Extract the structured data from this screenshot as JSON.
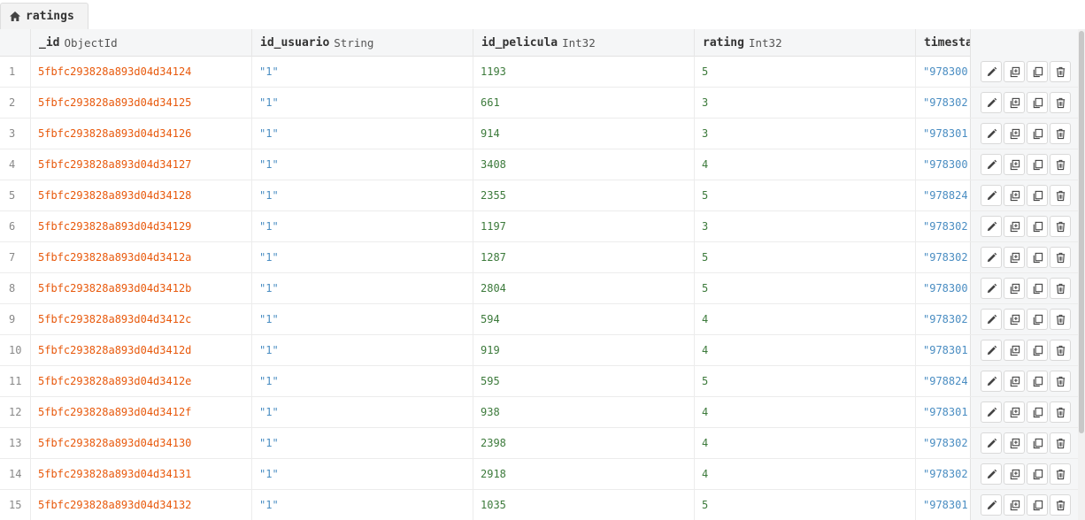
{
  "tab": {
    "icon": "home-icon",
    "label": "ratings"
  },
  "columns": [
    {
      "name": "_id",
      "type": "ObjectId"
    },
    {
      "name": "id_usuario",
      "type": "String"
    },
    {
      "name": "id_pelicula",
      "type": "Int32"
    },
    {
      "name": "rating",
      "type": "Int32"
    },
    {
      "name": "timesta",
      "type": ""
    }
  ],
  "actions": [
    "edit-icon",
    "clone-icon",
    "copy-icon",
    "delete-icon"
  ],
  "rows": [
    {
      "n": "1",
      "id": "5fbfc293828a893d04d34124",
      "usuario": "\"1\"",
      "pelicula": "1193",
      "rating": "5",
      "ts": "\"978300"
    },
    {
      "n": "2",
      "id": "5fbfc293828a893d04d34125",
      "usuario": "\"1\"",
      "pelicula": "661",
      "rating": "3",
      "ts": "\"978302"
    },
    {
      "n": "3",
      "id": "5fbfc293828a893d04d34126",
      "usuario": "\"1\"",
      "pelicula": "914",
      "rating": "3",
      "ts": "\"978301"
    },
    {
      "n": "4",
      "id": "5fbfc293828a893d04d34127",
      "usuario": "\"1\"",
      "pelicula": "3408",
      "rating": "4",
      "ts": "\"978300"
    },
    {
      "n": "5",
      "id": "5fbfc293828a893d04d34128",
      "usuario": "\"1\"",
      "pelicula": "2355",
      "rating": "5",
      "ts": "\"978824"
    },
    {
      "n": "6",
      "id": "5fbfc293828a893d04d34129",
      "usuario": "\"1\"",
      "pelicula": "1197",
      "rating": "3",
      "ts": "\"978302"
    },
    {
      "n": "7",
      "id": "5fbfc293828a893d04d3412a",
      "usuario": "\"1\"",
      "pelicula": "1287",
      "rating": "5",
      "ts": "\"978302"
    },
    {
      "n": "8",
      "id": "5fbfc293828a893d04d3412b",
      "usuario": "\"1\"",
      "pelicula": "2804",
      "rating": "5",
      "ts": "\"978300"
    },
    {
      "n": "9",
      "id": "5fbfc293828a893d04d3412c",
      "usuario": "\"1\"",
      "pelicula": "594",
      "rating": "4",
      "ts": "\"978302"
    },
    {
      "n": "10",
      "id": "5fbfc293828a893d04d3412d",
      "usuario": "\"1\"",
      "pelicula": "919",
      "rating": "4",
      "ts": "\"978301"
    },
    {
      "n": "11",
      "id": "5fbfc293828a893d04d3412e",
      "usuario": "\"1\"",
      "pelicula": "595",
      "rating": "5",
      "ts": "\"978824"
    },
    {
      "n": "12",
      "id": "5fbfc293828a893d04d3412f",
      "usuario": "\"1\"",
      "pelicula": "938",
      "rating": "4",
      "ts": "\"978301"
    },
    {
      "n": "13",
      "id": "5fbfc293828a893d04d34130",
      "usuario": "\"1\"",
      "pelicula": "2398",
      "rating": "4",
      "ts": "\"978302"
    },
    {
      "n": "14",
      "id": "5fbfc293828a893d04d34131",
      "usuario": "\"1\"",
      "pelicula": "2918",
      "rating": "4",
      "ts": "\"978302"
    },
    {
      "n": "15",
      "id": "5fbfc293828a893d04d34132",
      "usuario": "\"1\"",
      "pelicula": "1035",
      "rating": "5",
      "ts": "\"978301"
    }
  ]
}
